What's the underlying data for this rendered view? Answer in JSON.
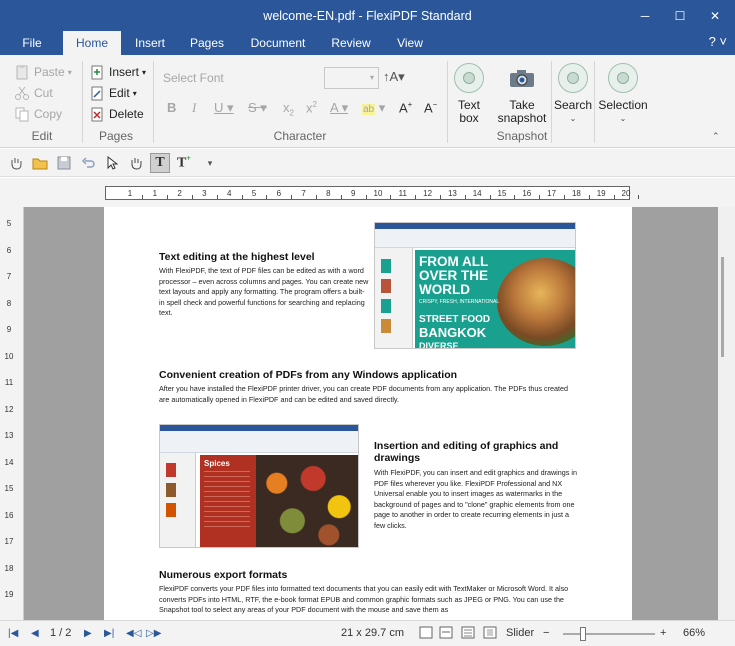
{
  "window": {
    "title": "welcome-EN.pdf - FlexiPDF Standard",
    "minimize": "─",
    "maximize": "☐",
    "close": "✕"
  },
  "tabs": [
    "File",
    "Home",
    "Insert",
    "Pages",
    "Document",
    "Review",
    "View"
  ],
  "help": "? ˅",
  "ribbon": {
    "edit": {
      "paste": "Paste",
      "cut": "Cut",
      "copy": "Copy",
      "label": "Edit"
    },
    "pages": {
      "insert": "Insert",
      "edit": "Edit",
      "delete": "Delete",
      "label": "Pages"
    },
    "character": {
      "font_placeholder": "Select Font",
      "label": "Character"
    },
    "textbox": "Text box",
    "snapshot": {
      "take": "Take snapshot",
      "label": "Snapshot"
    },
    "search": "Search",
    "selection": "Selection"
  },
  "ruler": {
    "h_ticks": [
      "1",
      "1",
      "2",
      "3",
      "4",
      "5",
      "6",
      "7",
      "8",
      "9",
      "10",
      "11",
      "12",
      "13",
      "14",
      "15",
      "16",
      "17",
      "18",
      "19",
      "20"
    ],
    "v_ticks": [
      "5",
      "6",
      "7",
      "8",
      "9",
      "10",
      "11",
      "12",
      "13",
      "14",
      "15",
      "16",
      "17",
      "18",
      "19"
    ]
  },
  "document": {
    "s1_title": "Text editing at the highest level",
    "s1_body": "With FlexiPDF, the text of PDF files can be edited as with a word processor – even across columns and pages. You can create new text layouts and apply any formatting. The program offers a built-in spell check and powerful functions for searching and replacing text.",
    "img1": {
      "title": "FROM ALL OVER THE WORLD",
      "sub": "CRISPY, FRESH, INTERNATIONAL",
      "city_a": "STREET FOOD",
      "city_b": "BANGKOK",
      "extra": "DIVERSE"
    },
    "s2_title": "Convenient creation of PDFs from any Windows application",
    "s2_body": "After you have installed the FlexiPDF printer driver, you can create PDF documents from any application. The PDFs thus created are automatically opened in FlexiPDF and can be edited and saved directly.",
    "img2": {
      "title": "Spices"
    },
    "s3_title": "Insertion and editing of graphics and drawings",
    "s3_body": "With FlexiPDF, you can insert and edit graphics and drawings in PDF files wherever you like. FlexiPDF Professional and NX Universal enable you to insert images as watermarks in the background of pages and to \"clone\" graphic elements from one page to another in order to create recurring elements in just a few clicks.",
    "s4_title": "Numerous export formats",
    "s4_body": "FlexiPDF converts your PDF files into formatted text documents that you can easily edit with TextMaker or Microsoft Word. It also converts PDFs into HTML, RTF, the e-book format EPUB and common graphic formats such as JPEG or PNG. You can use the Snapshot tool to select any areas of your PDF document with the mouse and save them as"
  },
  "status": {
    "page": "1 / 2",
    "size": "21 x 29.7 cm",
    "slider": "Slider",
    "minus": "−",
    "plus": "+",
    "zoom": "66%",
    "zoom_level": 0.66
  },
  "colors": {
    "brand": "#2b579a",
    "food_teal": "#1aa08f",
    "spice_red": "#c0392b"
  }
}
